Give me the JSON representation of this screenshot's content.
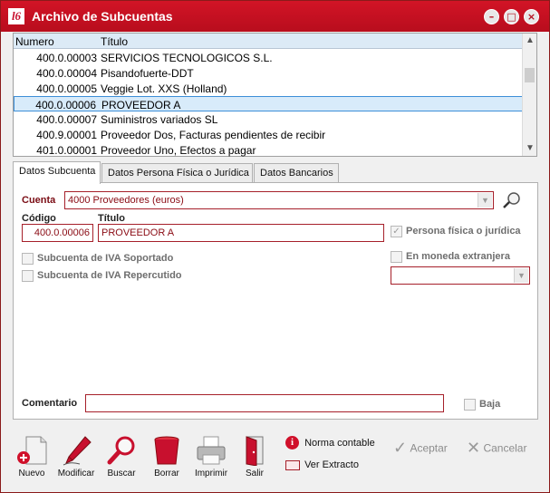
{
  "window": {
    "logo": "l6",
    "title": "Archivo de Subcuentas",
    "minimize": "–",
    "maximize": "□",
    "close": "×"
  },
  "list": {
    "columns": [
      "Numero",
      "Título"
    ],
    "rows": [
      {
        "numero": "400.0.00003",
        "titulo": "SERVICIOS TECNOLOGICOS S.L."
      },
      {
        "numero": "400.0.00004",
        "titulo": "Pisandofuerte-DDT"
      },
      {
        "numero": "400.0.00005",
        "titulo": "Veggie Lot. XXS (Holland)"
      },
      {
        "numero": "400.0.00006",
        "titulo": "PROVEEDOR A"
      },
      {
        "numero": "400.0.00007",
        "titulo": "Suministros variados SL"
      },
      {
        "numero": "400.9.00001",
        "titulo": "Proveedor Dos, Facturas pendientes de recibir"
      },
      {
        "numero": "401.0.00001",
        "titulo": "Proveedor Uno, Efectos a pagar"
      }
    ],
    "selected_index": 3
  },
  "tabs": [
    "Datos Subcuenta",
    "Datos Persona Física o Jurídica",
    "Datos Bancarios"
  ],
  "form": {
    "cuenta_label": "Cuenta",
    "cuenta_value": "4000  Proveedores (euros)",
    "codigo_label": "Código",
    "codigo_value": "400.0.00006",
    "titulo_label": "Título",
    "titulo_value": "PROVEEDOR A",
    "persona_label": "Persona física o jurídica",
    "persona_checked": true,
    "moneda_label": "En moneda extranjera",
    "moneda_checked": false,
    "moneda_select_value": "",
    "iva_soportado_label": "Subcuenta de IVA Soportado",
    "iva_repercutido_label": "Subcuenta de IVA Repercutido",
    "comentario_label": "Comentario",
    "comentario_value": "",
    "baja_label": "Baja",
    "baja_checked": false
  },
  "toolbar": {
    "nuevo": "Nuevo",
    "modificar": "Modificar",
    "buscar": "Buscar",
    "borrar": "Borrar",
    "imprimir": "Imprimir",
    "salir": "Salir",
    "norma_contable": "Norma contable",
    "ver_extracto": "Ver Extracto",
    "aceptar": "Aceptar",
    "cancelar": "Cancelar"
  },
  "colors": {
    "title_bar": "#c8102e",
    "field_border": "#a6202a",
    "label_red": "#7a0c14",
    "selection": "#d8ebfa"
  },
  "icons": {
    "app": "app-logo-icon",
    "search": "magnifier-icon",
    "nuevo": "new-document-icon",
    "modificar": "pen-icon",
    "buscar": "magnifier-icon",
    "borrar": "trash-bin-icon",
    "imprimir": "printer-icon",
    "salir": "door-exit-icon",
    "norma": "info-icon",
    "extracto": "statement-icon",
    "aceptar": "check-icon",
    "cancelar": "cross-icon"
  }
}
